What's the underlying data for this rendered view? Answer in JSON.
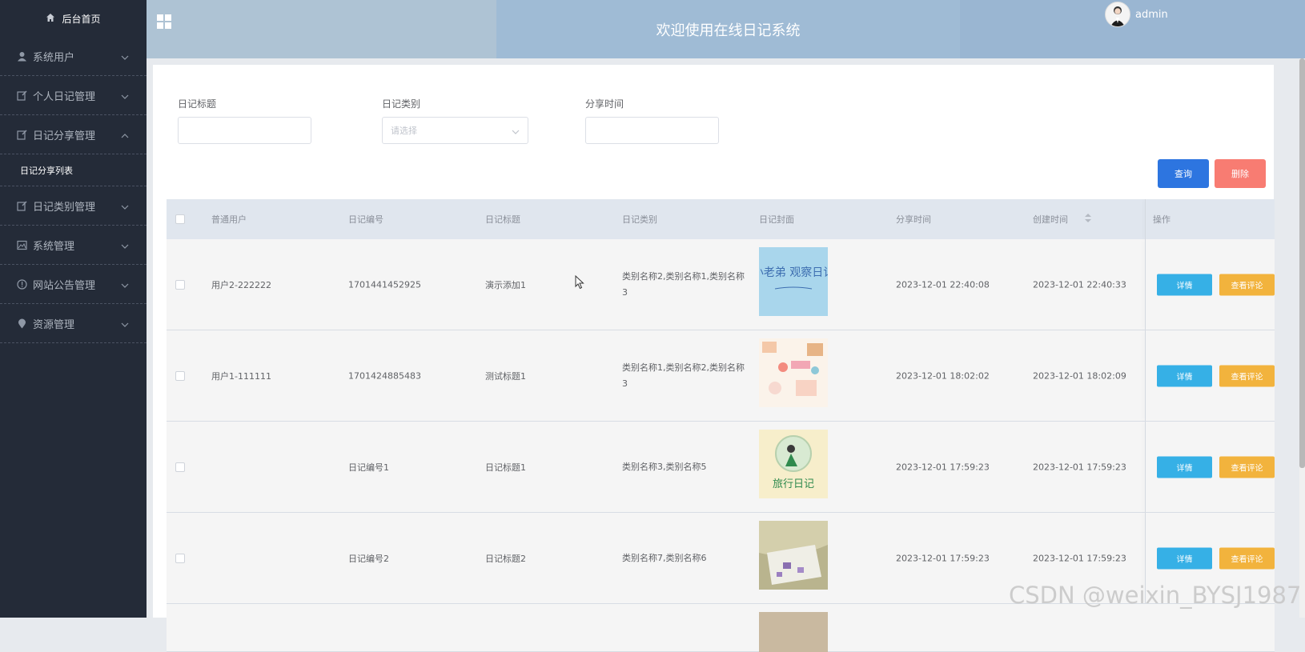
{
  "sidebar": {
    "home_label": "后台首页",
    "items": [
      {
        "label": "系统用户",
        "icon": "user-icon"
      },
      {
        "label": "个人日记管理",
        "icon": "edit-icon"
      },
      {
        "label": "日记分享管理",
        "icon": "edit-icon",
        "expanded": true
      },
      {
        "label": "日记类别管理",
        "icon": "edit-icon"
      },
      {
        "label": "系统管理",
        "icon": "picture-icon"
      },
      {
        "label": "网站公告管理",
        "icon": "info-icon"
      },
      {
        "label": "资源管理",
        "icon": "location-icon"
      }
    ],
    "subitem": "日记分享列表"
  },
  "header": {
    "title": "欢迎使用在线日记系统",
    "username": "admin"
  },
  "filters": {
    "title_label": "日记标题",
    "category_label": "日记类别",
    "category_placeholder": "请选择",
    "time_label": "分享时间"
  },
  "buttons": {
    "search": "查询",
    "delete": "删除"
  },
  "table": {
    "headers": [
      "普通用户",
      "日记编号",
      "日记标题",
      "日记类别",
      "日记封面",
      "分享时间",
      "创建时间",
      "操作"
    ],
    "rows": [
      {
        "user": "用户2-222222",
        "id": "1701441452925",
        "title": "演示添加1",
        "category": "类别名称2,类别名称1,类别名称3",
        "share_time": "2023-12-01 22:40:08",
        "create_time": "2023-12-01 22:40:33",
        "cover": "小老弟 观察日记"
      },
      {
        "user": "用户1-111111",
        "id": "1701424885483",
        "title": "测试标题1",
        "category": "类别名称1,类别名称2,类别名称3",
        "share_time": "2023-12-01 18:02:02",
        "create_time": "2023-12-01 18:02:09",
        "cover": ""
      },
      {
        "user": "",
        "id": "日记编号1",
        "title": "日记标题1",
        "category": "类别名称3,类别名称5",
        "share_time": "2023-12-01 17:59:23",
        "create_time": "2023-12-01 17:59:23",
        "cover": "旅行日记"
      },
      {
        "user": "",
        "id": "日记编号2",
        "title": "日记标题2",
        "category": "类别名称7,类别名称6",
        "share_time": "2023-12-01 17:59:23",
        "create_time": "2023-12-01 17:59:23",
        "cover": ""
      }
    ],
    "detail_label": "详情",
    "comments_label": "查看评论"
  },
  "watermark": "CSDN @weixin_BYSJ1987",
  "colors": {
    "sidebar_bg": "#242b38",
    "search_btn": "#2d75e0",
    "delete_btn": "#f87c72",
    "detail_btn": "#36b0e6",
    "comment_btn": "#f2b33d"
  }
}
